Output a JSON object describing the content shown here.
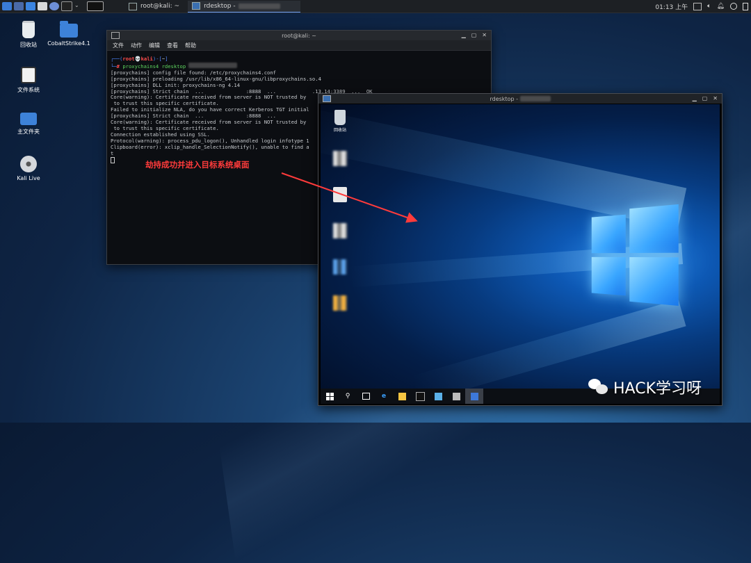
{
  "panel": {
    "tasks": [
      {
        "label": "root@kali: ~"
      },
      {
        "label": "rdesktop -"
      }
    ],
    "clock": "01:13 上午"
  },
  "desktop": {
    "icons": [
      {
        "label": "回收站",
        "icon": "trash-icon"
      },
      {
        "label": "CobaltStrike4.1",
        "icon": "folder-icon"
      },
      {
        "label": "文件系统",
        "icon": "drive-icon"
      },
      {
        "label": "主文件夹",
        "icon": "home-folder-icon"
      },
      {
        "label": "Kali Live",
        "icon": "disc-icon"
      }
    ]
  },
  "terminal": {
    "title": "root@kali: ~",
    "menu": [
      "文件",
      "动作",
      "编辑",
      "查看",
      "帮助"
    ],
    "prompt_user": "root",
    "prompt_host": "kali",
    "prompt_dir": "~",
    "command": "proxychains4 rdesktop",
    "lines": [
      "[proxychains] config file found: /etc/proxychains4.conf",
      "[proxychains] preloading /usr/lib/x86_64-linux-gnu/libproxychains.so.4",
      "[proxychains] DLL init: proxychains-ng 4.14",
      "[proxychains] Strict chain  ...              :8888  ...            .13.14:3389  ...  OK",
      "Core(warning): Certificate received from server is NOT trusted by",
      " to trust this specific certificate.",
      "Failed to initialize NLA, do you have correct Kerberos TGT initial",
      "[proxychains] Strict chain  ...              :8888  ...  ",
      "Core(warning): Certificate received from server is NOT trusted by",
      " to trust this specific certificate.",
      "Connection established using SSL.",
      "Protocol(warning): process_pdu_logon(), Unhandled login infotype 1",
      "Clipboard(error): xclip_handle_SelectionNotify(), unable to find a",
      "t"
    ]
  },
  "rdesktop": {
    "title": "rdesktop -",
    "recycle_label": "回收站"
  },
  "annotation": "劫持成功并进入目标系统桌面",
  "watermark": "HACK学习呀"
}
